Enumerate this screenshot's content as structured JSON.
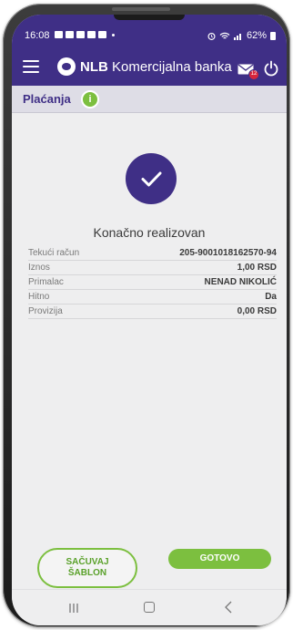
{
  "status_bar": {
    "time": "16:08",
    "battery": "62%"
  },
  "app": {
    "brand_bold": "NLB",
    "brand_rest": "Komercijalna banka",
    "mail_badge": "12"
  },
  "section": {
    "title": "Plaćanja",
    "info_symbol": "i"
  },
  "result": {
    "status": "Konačno realizovan",
    "rows": [
      {
        "label": "Tekući račun",
        "value": "205-9001018162570-94"
      },
      {
        "label": "Iznos",
        "value": "1,00 RSD"
      },
      {
        "label": "Primalac",
        "value": "NENAD NIKOLIĆ"
      },
      {
        "label": "Hitno",
        "value": "Da"
      },
      {
        "label": "Provizija",
        "value": "0,00 RSD"
      }
    ]
  },
  "buttons": {
    "save_template_line1": "SAČUVAJ",
    "save_template_line2": "ŠABLON",
    "done": "GOTOVO"
  },
  "icons": {
    "menu": "menu-icon",
    "mail": "mail-icon",
    "power": "power-icon",
    "info": "info-icon",
    "check": "check-icon",
    "recent": "recent-apps-icon",
    "home": "home-icon",
    "back": "back-icon"
  },
  "colors": {
    "brand_purple": "#3f2f86",
    "accent_green": "#7cbf3f",
    "badge_red": "#d7263d"
  }
}
